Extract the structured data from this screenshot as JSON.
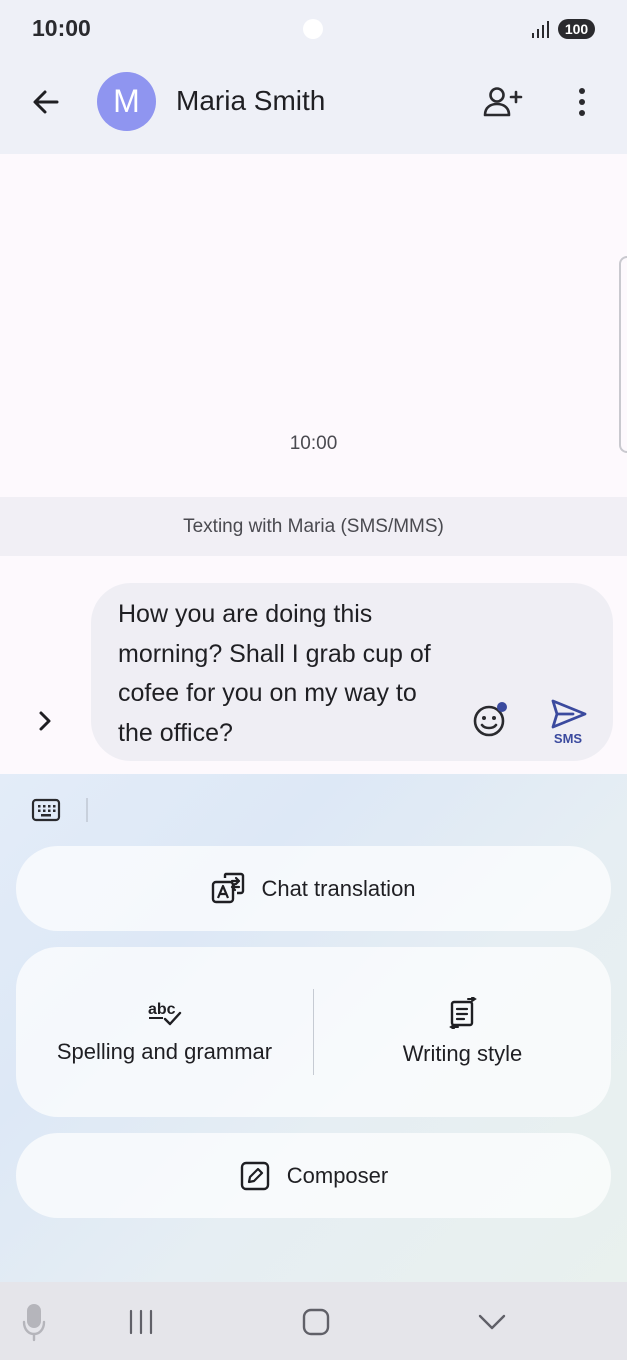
{
  "status_bar": {
    "time": "10:00",
    "battery": "100"
  },
  "header": {
    "avatar_letter": "M",
    "contact_name": "Maria Smith"
  },
  "conversation": {
    "timestamp": "10:00",
    "banner": "Texting with Maria (SMS/MMS)"
  },
  "composer": {
    "message": "How you are doing this morning? Shall I grab cup of cofee for you on my way to the office?",
    "send_label": "SMS"
  },
  "tools": {
    "chat_translation": "Chat translation",
    "spelling_grammar": "Spelling and grammar",
    "writing_style": "Writing style",
    "composer": "Composer"
  },
  "colors": {
    "avatar": "#8f95f0",
    "accent": "#3b4a9e"
  },
  "icons": [
    "back-arrow-icon",
    "add-person-icon",
    "more-vert-icon",
    "chevron-right-icon",
    "emoji-icon",
    "send-icon",
    "keyboard-icon",
    "translate-icon",
    "spellcheck-icon",
    "writing-style-icon",
    "edit-icon",
    "mic-icon",
    "recents-icon",
    "home-icon",
    "nav-down-icon"
  ]
}
